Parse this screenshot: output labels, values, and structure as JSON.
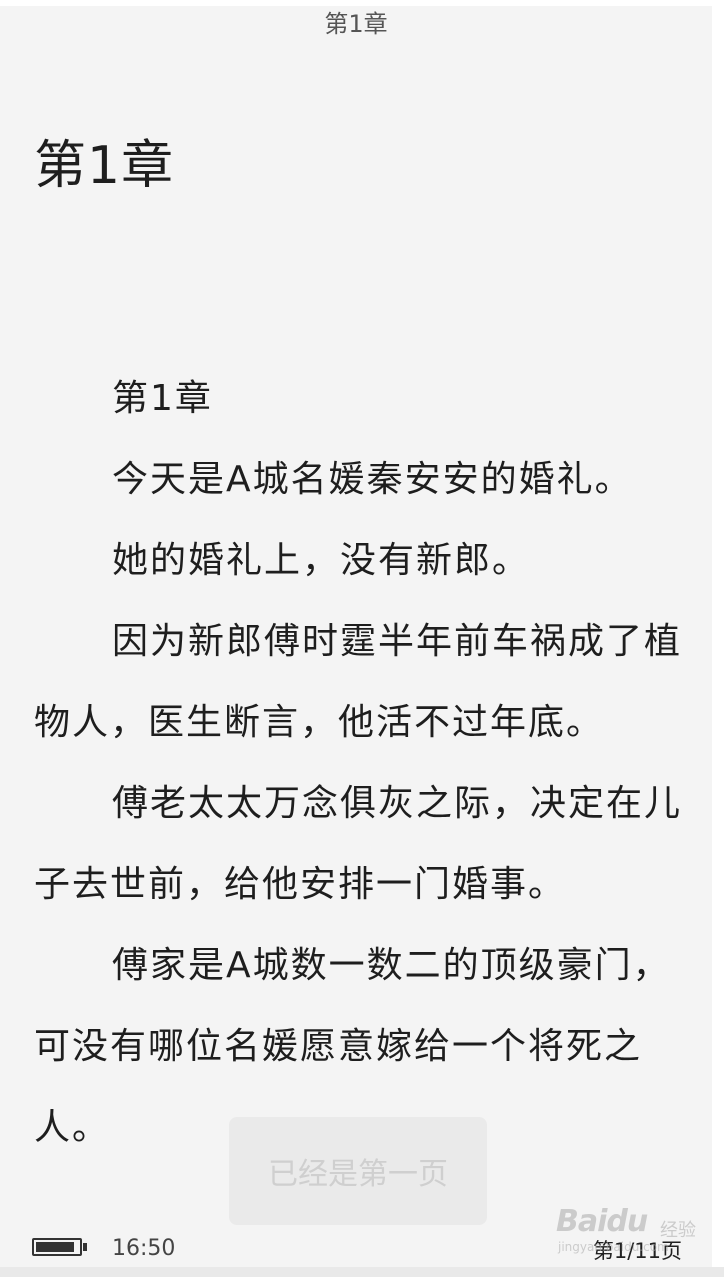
{
  "header": {
    "title": "第1章"
  },
  "chapter": {
    "heading": "第1章",
    "paragraphs": [
      "第1章",
      "今天是A城名媛秦安安的婚礼。",
      "她的婚礼上，没有新郎。",
      "因为新郎傅时霆半年前车祸成了植物人，医生断言，他活不过年底。",
      "傅老太太万念俱灰之际，决定在儿子去世前，给他安排一门婚事。",
      " 傅家是A城数一数二的顶级豪门，可没有哪位名媛愿意嫁给一个将死之人。"
    ]
  },
  "toast": {
    "message": "已经是第一页"
  },
  "status_bar": {
    "battery_level": 0.9,
    "time": "16:50",
    "page_indicator": "第1/11页"
  },
  "watermark": {
    "brand": "Baidu",
    "sub": "经验",
    "url": "jingyan.baidu.com"
  },
  "colors": {
    "background": "#f4f4f4",
    "text": "#1e1e1e",
    "muted": "#555555"
  }
}
